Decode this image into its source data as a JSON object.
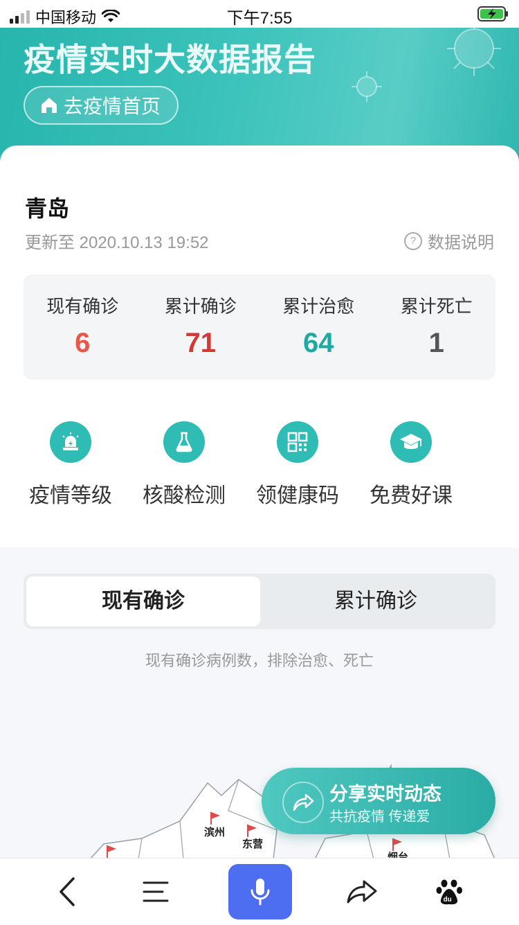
{
  "status_bar": {
    "carrier": "中国移动",
    "time": "下午7:55"
  },
  "hero": {
    "title": "疫情实时大数据报告",
    "home_button": "去疫情首页"
  },
  "region": {
    "city": "青岛",
    "updated": "更新至 2020.10.13 19:52",
    "data_note": "数据说明",
    "data_note_icon": "?"
  },
  "stats": [
    {
      "label": "现有确诊",
      "value": "6",
      "color": "#e8584a"
    },
    {
      "label": "累计确诊",
      "value": "71",
      "color": "#d23a35"
    },
    {
      "label": "累计治愈",
      "value": "64",
      "color": "#1ea9a3"
    },
    {
      "label": "累计死亡",
      "value": "1",
      "color": "#555555"
    }
  ],
  "tools": [
    {
      "label": "疫情等级",
      "icon": "alarm-icon"
    },
    {
      "label": "核酸检测",
      "icon": "flask-icon"
    },
    {
      "label": "领健康码",
      "icon": "qr-code-icon"
    },
    {
      "label": "免费好课",
      "icon": "graduation-cap-icon"
    }
  ],
  "tabs": {
    "active": "现有确诊",
    "other": "累计确诊"
  },
  "tab_description": "现有确诊病例数，排除治愈、死亡",
  "map_labels": {
    "binzhou": "滨州",
    "dongying": "东营",
    "yantai": "烟台"
  },
  "share": {
    "title": "分享实时动态",
    "subtitle": "共抗疫情 传递爱"
  },
  "bottom_nav": [
    "back-icon",
    "menu-icon",
    "microphone-icon",
    "share-icon",
    "baidu-paw-icon"
  ]
}
